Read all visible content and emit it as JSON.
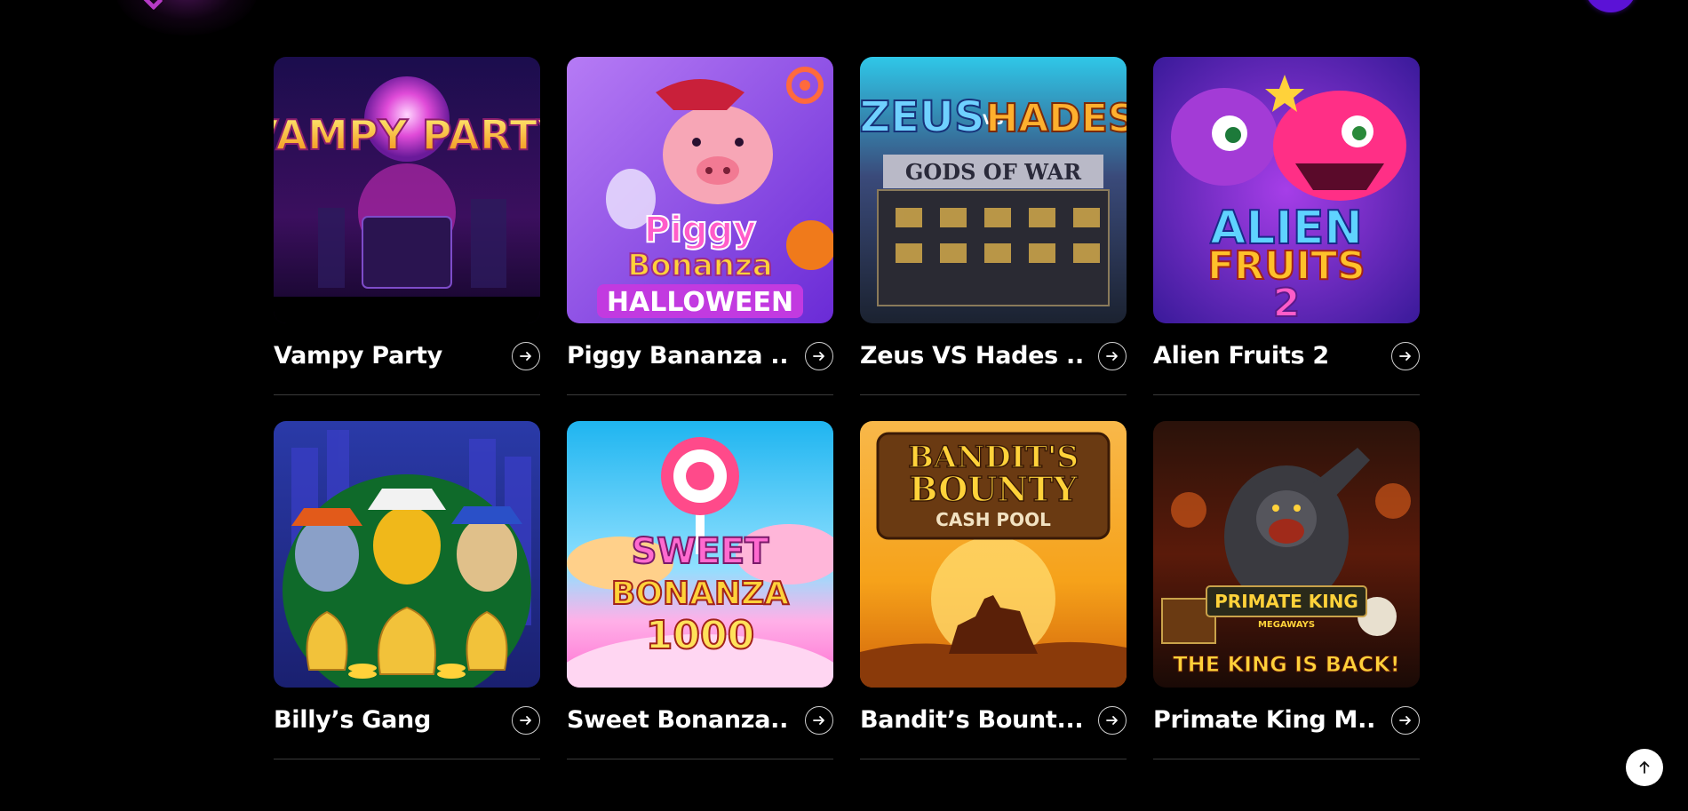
{
  "games": [
    {
      "title": "Vampy Party",
      "art_text": [
        "VAMPY PARTY"
      ],
      "theme": "disco vampire"
    },
    {
      "title": "Piggy Bananza ...",
      "art_text": [
        "Piggy",
        "Bonanza",
        "HALLOWEEN"
      ],
      "theme": "halloween pig"
    },
    {
      "title": "Zeus VS Hades ...",
      "art_text": [
        "ZEUS",
        "VS",
        "HADES",
        "GODS OF WAR"
      ],
      "theme": "gods slot"
    },
    {
      "title": "Alien Fruits 2",
      "art_text": [
        "ALIEN",
        "FRUITS",
        "2"
      ],
      "theme": "aliens"
    },
    {
      "title": "Billy’s Gang",
      "art_text": [],
      "theme": "rat gangsters"
    },
    {
      "title": "Sweet Bonanza...",
      "art_text": [
        "SWEET",
        "BONANZA",
        "1000"
      ],
      "theme": "candy"
    },
    {
      "title": "Bandit’s Bount...",
      "art_text": [
        "BANDIT'S",
        "BOUNTY",
        "CASH POOL"
      ],
      "theme": "western"
    },
    {
      "title": "Primate King M...",
      "art_text": [
        "PRIMATE KING",
        "MEGAWAYS",
        "THE KING IS BACK!"
      ],
      "theme": "gorilla"
    }
  ],
  "icons": {
    "card_arrow": "arrow-right-icon",
    "scroll_top": "arrow-up-icon"
  },
  "colors": {
    "background": "#000000",
    "accent_purple": "#5b12d6",
    "divider": "#3a3a3a"
  }
}
